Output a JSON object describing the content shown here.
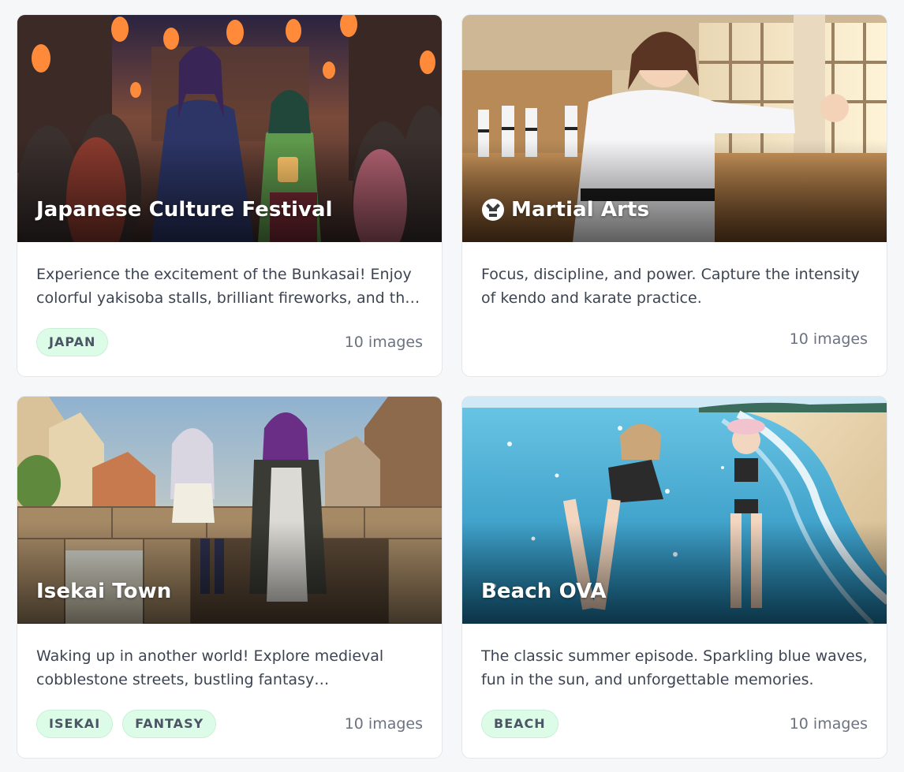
{
  "cards": [
    {
      "title": "Japanese Culture Festival",
      "description": "Experience the excitement of the Bunkasai! Enjoy colorful yakisoba stalls, brilliant fireworks, and th…",
      "tags": [
        "JAPAN"
      ],
      "count": "10 images",
      "icon": null
    },
    {
      "title": "Martial Arts",
      "description": "Focus, discipline, and power. Capture the intensity of kendo and karate practice.",
      "tags": [],
      "count": "10 images",
      "icon": "martial-arts-gi-icon"
    },
    {
      "title": "Isekai Town",
      "description": "Waking up in another world! Explore medieval cobblestone streets, bustling fantasy…",
      "tags": [
        "ISEKAI",
        "FANTASY"
      ],
      "count": "10 images",
      "icon": null
    },
    {
      "title": "Beach OVA",
      "description": "The classic summer episode. Sparkling blue waves, fun in the sun, and unforgettable memories.",
      "tags": [
        "BEACH"
      ],
      "count": "10 images",
      "icon": null
    }
  ],
  "colors": {
    "tag_bg": "#dcfce7",
    "tag_text": "#4b5563",
    "page_bg": "#f6f7f9"
  }
}
